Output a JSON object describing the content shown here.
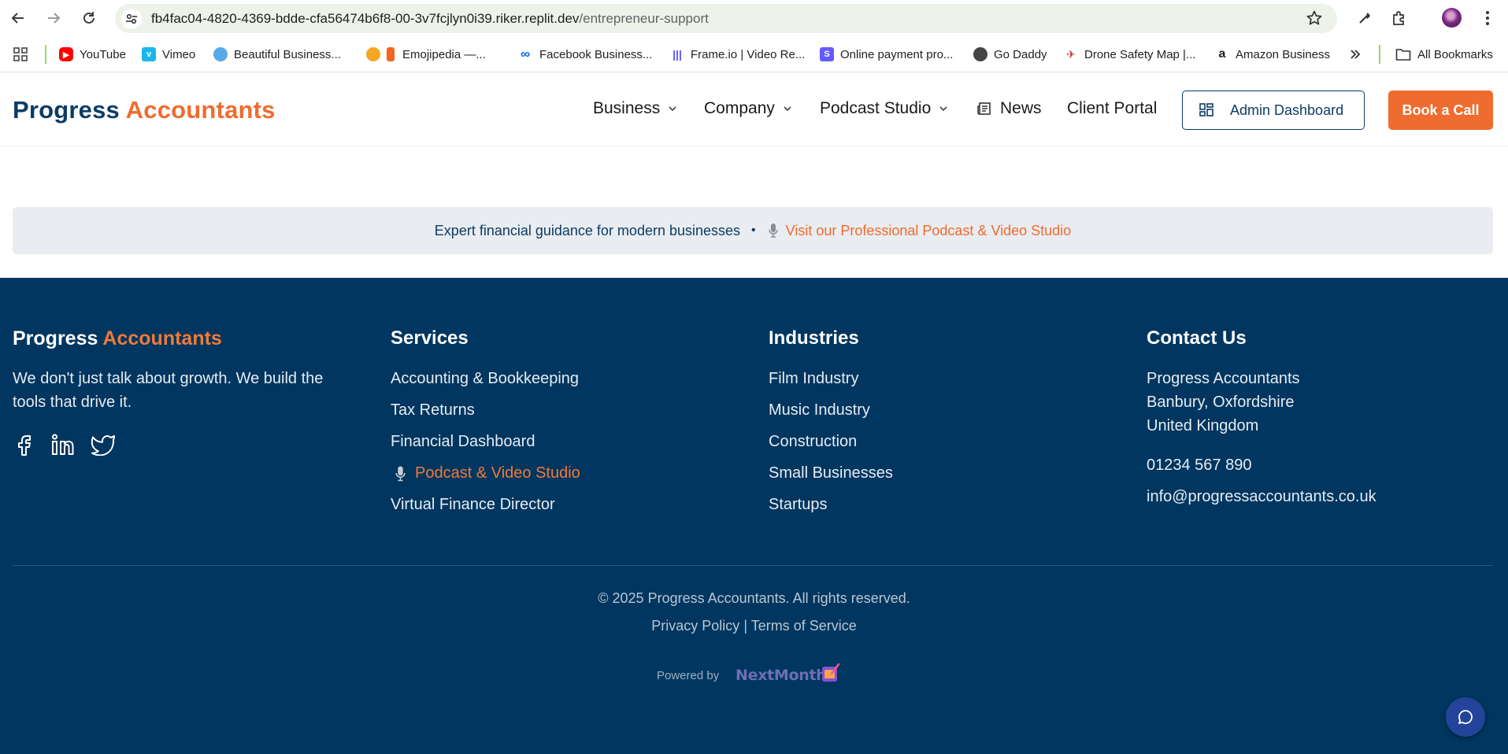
{
  "browser": {
    "url_host": "fb4fac04-4820-4369-bdde-cfa56474b6f8-00-3v7fcjlyn0i39.riker.replit.dev",
    "url_path": "/entrepreneur-support",
    "bookmarks": [
      {
        "label": "YouTube",
        "icon": "youtube-icon",
        "color": "#ff0000"
      },
      {
        "label": "Vimeo",
        "icon": "vimeo-icon",
        "color": "#1ab7ea"
      },
      {
        "label": "Beautiful Business...",
        "icon": "globe-icon",
        "color": "#5aa9e6"
      },
      {
        "label": "Emojipedia —...",
        "icon": "emojipedia-icon",
        "color": "#f26522"
      },
      {
        "label": "Facebook Business...",
        "icon": "meta-icon",
        "color": "#0866ff"
      },
      {
        "label": "Frame.io | Video Re...",
        "icon": "frameio-icon",
        "color": "#5b53ff"
      },
      {
        "label": "Online payment pro...",
        "icon": "stripe-icon",
        "color": "#635bff"
      },
      {
        "label": "Go Daddy",
        "icon": "globe-icon",
        "color": "#444444"
      },
      {
        "label": "Drone Safety Map |...",
        "icon": "drone-icon",
        "color": "#d0312d"
      },
      {
        "label": "Amazon Business",
        "icon": "amazon-icon",
        "color": "#222222"
      }
    ],
    "all_bookmarks_label": "All Bookmarks"
  },
  "header": {
    "logo_part1": "Progress",
    "logo_part2": "Accountants",
    "nav": {
      "business": "Business",
      "company": "Company",
      "podcast_studio": "Podcast Studio",
      "news": "News",
      "client_portal": "Client Portal"
    },
    "admin_button": "Admin Dashboard",
    "book_button": "Book a Call"
  },
  "banner": {
    "text": "Expert financial guidance for modern businesses",
    "separator": "•",
    "link": "Visit our Professional Podcast & Video Studio"
  },
  "footer": {
    "logo_part1": "Progress",
    "logo_part2": "Accountants",
    "tagline": "We don't just talk about growth. We build the tools that drive it.",
    "services": {
      "heading": "Services",
      "items": [
        "Accounting & Bookkeeping",
        "Tax Returns",
        "Financial Dashboard",
        "Podcast & Video Studio",
        "Virtual Finance Director"
      ]
    },
    "industries": {
      "heading": "Industries",
      "items": [
        "Film Industry",
        "Music Industry",
        "Construction",
        "Small Businesses",
        "Startups"
      ]
    },
    "contact": {
      "heading": "Contact Us",
      "address_line1": "Progress Accountants",
      "address_line2": "Banbury, Oxfordshire",
      "address_line3": "United Kingdom",
      "phone": "01234 567 890",
      "email": "info@progressaccountants.co.uk"
    },
    "copyright": "© 2025 Progress Accountants. All rights reserved.",
    "privacy": "Privacy Policy",
    "legal_sep": "|",
    "terms": "Terms of Service",
    "powered_by": "Powered by",
    "powered_brand": "NextMonth"
  },
  "colors": {
    "brand_navy": "#0e3b66",
    "brand_orange": "#ef6c2f",
    "footer_bg": "#00365f"
  }
}
